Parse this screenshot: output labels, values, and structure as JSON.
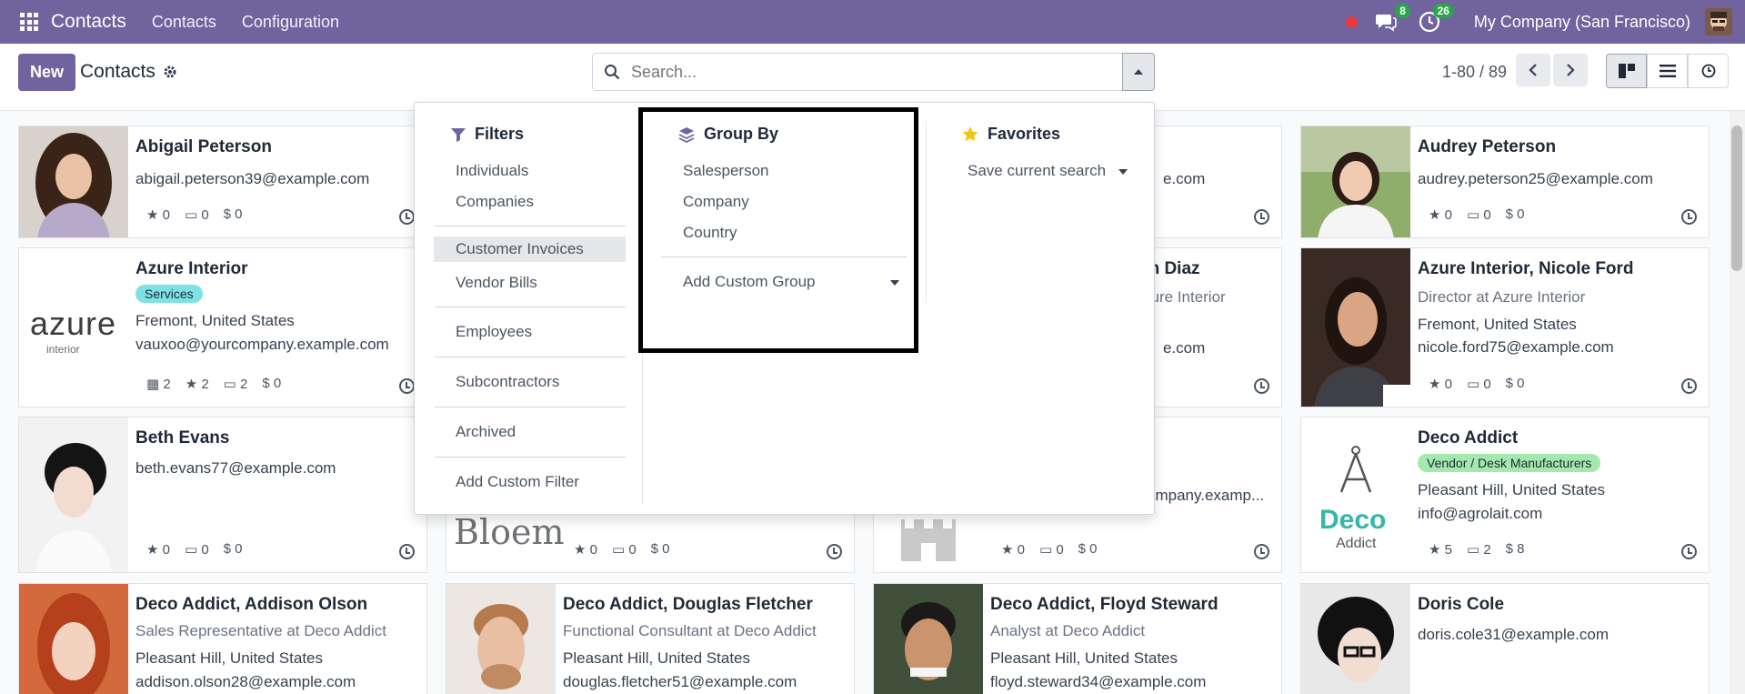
{
  "navbar": {
    "app_title": "Contacts",
    "menu": [
      "Contacts",
      "Configuration"
    ],
    "messages_count": "8",
    "activities_count": "26",
    "company": "My Company (San Francisco)"
  },
  "control": {
    "new_label": "New",
    "title": "Contacts",
    "search_placeholder": "Search...",
    "pager": "1-80 / 89"
  },
  "cards": [
    {
      "name": "Abigail Peterson",
      "email": "abigail.peterson39@example.com",
      "stats": [
        "0",
        "0",
        "0"
      ]
    },
    {
      "name": "Audrey Peterson",
      "email": "audrey.peterson25@example.com",
      "stats": [
        "0",
        "0",
        "0"
      ]
    },
    {
      "name": "Azure Interior",
      "tag": "Services",
      "location": "Fremont, United States",
      "email": "vauxoo@yourcompany.example.com",
      "stats": [
        "2",
        "2",
        "2",
        "0"
      ],
      "logo_text": "azure",
      "logo_sub": "interior"
    },
    {
      "name_partial": "en Diaz",
      "subtitle_partial": "zure Interior",
      "email_partial": "e.com"
    },
    {
      "name": "Azure Interior, Nicole Ford",
      "subtitle": "Director at Azure Interior",
      "location": "Fremont, United States",
      "email": "nicole.ford75@example.com",
      "stats": [
        "0",
        "0",
        "0"
      ]
    },
    {
      "name": "Beth Evans",
      "email": "beth.evans77@example.com",
      "stats": [
        "0",
        "0",
        "0"
      ]
    },
    {
      "logo_text": "Bloem",
      "stats": [
        "0",
        "0",
        "0"
      ]
    },
    {
      "email_partial": "ompany.examp...",
      "stats": [
        "0",
        "0",
        "0"
      ]
    },
    {
      "name": "Deco Addict",
      "tag": "Vendor / Desk Manufacturers",
      "location": "Pleasant Hill, United States",
      "email": "info@agrolait.com",
      "stats": [
        "5",
        "2",
        "8"
      ],
      "logo_text": "Deco",
      "logo_sub": "Addict"
    },
    {
      "name": "Deco Addict, Addison Olson",
      "subtitle": "Sales Representative at Deco Addict",
      "location": "Pleasant Hill, United States",
      "email": "addison.olson28@example.com"
    },
    {
      "name": "Deco Addict, Douglas Fletcher",
      "subtitle": "Functional Consultant at Deco Addict",
      "location": "Pleasant Hill, United States",
      "email": "douglas.fletcher51@example.com"
    },
    {
      "name": "Deco Addict, Floyd Steward",
      "subtitle": "Analyst at Deco Addict",
      "location": "Pleasant Hill, United States",
      "email": "floyd.steward34@example.com"
    },
    {
      "name": "Doris Cole",
      "email": "doris.cole31@example.com"
    }
  ],
  "dropdown": {
    "filters": {
      "title": "Filters",
      "items": [
        "Individuals",
        "Companies",
        "Customer Invoices",
        "Vendor Bills",
        "Employees",
        "Subcontractors",
        "Archived",
        "Add Custom Filter"
      ]
    },
    "group_by": {
      "title": "Group By",
      "items": [
        "Salesperson",
        "Company",
        "Country"
      ],
      "custom": "Add Custom Group"
    },
    "favorites": {
      "title": "Favorites",
      "save": "Save current search"
    }
  },
  "colors": {
    "brand": "#71639e",
    "tag_services": "#7ee2e4",
    "tag_vendor": "#a3e8ad",
    "deco_teal": "#37b5a8"
  },
  "currency_symbol": "$"
}
